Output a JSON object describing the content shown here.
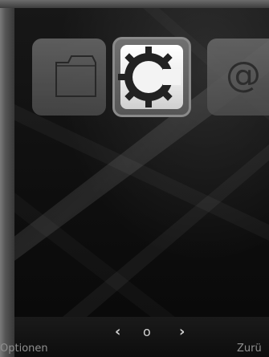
{
  "menu": {
    "icons": [
      {
        "name": "folder-icon",
        "selected": false
      },
      {
        "name": "gear-icon",
        "selected": true
      },
      {
        "name": "at-sign-icon",
        "selected": false
      }
    ]
  },
  "navigation": {
    "left_glyph": "‹",
    "dot_glyph": "o",
    "right_glyph": "›"
  },
  "softkeys": {
    "left_label": "Optionen",
    "right_label": "Zurü"
  }
}
